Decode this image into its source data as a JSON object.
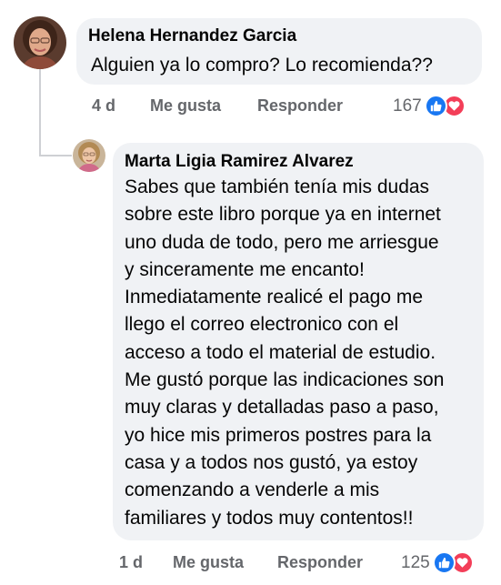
{
  "comments": [
    {
      "author": "Helena Hernandez Garcia",
      "lines": [
        "Alguien ya lo compro? Lo recomienda??"
      ],
      "time": "4 d",
      "like_label": "Me gusta",
      "reply_label": "Responder",
      "reaction_count": "167",
      "reaction_icons": [
        "like-icon",
        "love-icon"
      ]
    },
    {
      "author": "Marta Ligia Ramirez Alvarez",
      "lines": [
        "Sabes que también tenía mis dudas",
        "sobre este libro porque ya en internet",
        "uno duda de todo, pero me arriesgue",
        "y sinceramente me encanto!",
        "Inmediatamente realicé el pago me",
        "llego el correo electronico con el",
        "acceso a todo el material de estudio.",
        "Me gustó porque las indicaciones son",
        "muy claras y detalladas paso a paso,",
        "yo hice mis primeros postres para la",
        "casa y a todos nos gustó, ya estoy",
        "comenzando a venderle a mis",
        "familiares y todos muy contentos!!"
      ],
      "time": "1 d",
      "like_label": "Me gusta",
      "reply_label": "Responder",
      "reaction_count": "125",
      "reaction_icons": [
        "like-icon",
        "love-icon"
      ]
    }
  ],
  "colors": {
    "bubble": "#f0f2f5",
    "action_text": "#65676b",
    "like": "#1877f2",
    "love": "#f33e58",
    "thread_line": "#ced0d4"
  }
}
